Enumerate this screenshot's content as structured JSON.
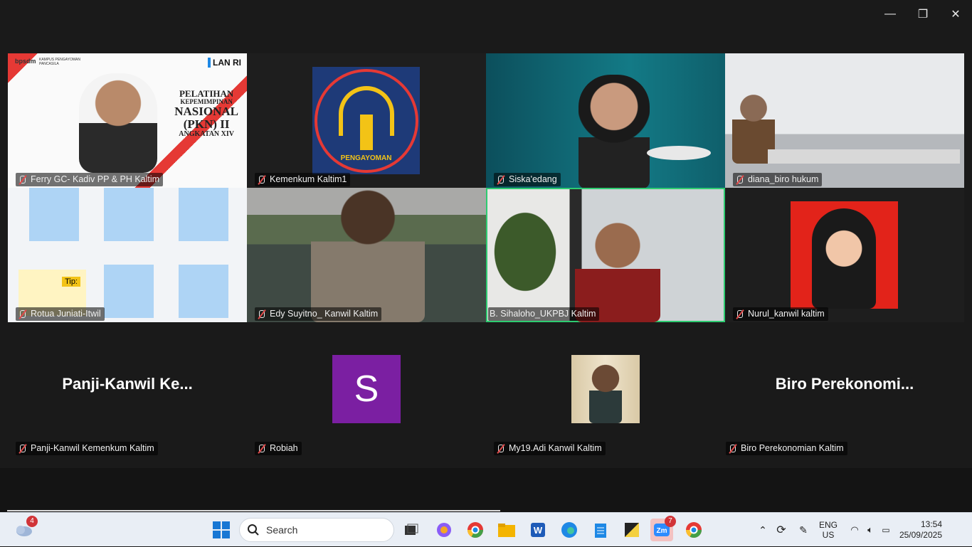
{
  "window_controls": {
    "minimize": "—",
    "restore": "❐",
    "close": "✕"
  },
  "tiles": [
    {
      "name": "Ferry GC- Kadiv PP & PH Kaltim",
      "banner": {
        "org": "bpsdm",
        "campus": "KAMPUS PENGAYOMAN PANCASILA",
        "logo": "LAN RI",
        "line1": "PELATIHAN",
        "line2": "KEPEMIMPINAN",
        "line3": "NASIONAL",
        "line4": "(PKN) II",
        "line5": "ANGKATAN XIV"
      }
    },
    {
      "name": "Kemenkum Kaltim1",
      "logo_text": "PENGAYOMAN"
    },
    {
      "name": "Siska'edang"
    },
    {
      "name": "diana_biro hukum"
    },
    {
      "name": "Rotua Juniati-Itwil",
      "tip": "Tip:"
    },
    {
      "name": "Edy Suyitno_ Kanwil Kaltim"
    },
    {
      "name": "B. Sihaloho_UKPBJ Kaltim"
    },
    {
      "name": "Nurul_kanwil kaltim"
    },
    {
      "name": "Panji-Kanwil Kemenkum Kaltim",
      "display": "Panji-Kanwil  Ke..."
    },
    {
      "name": "Robiah",
      "avatar_letter": "S"
    },
    {
      "name": "My19.Adi Kanwil Kaltim"
    },
    {
      "name": "Biro Perekonomian Kaltim",
      "display": "Biro  Perekonomi..."
    }
  ],
  "taskbar": {
    "weather_badge": "4",
    "search_placeholder": "Search",
    "zoom_badge": "7",
    "lang_top": "ENG",
    "lang_bottom": "US",
    "time": "13:54",
    "date": "25/09/2025"
  }
}
